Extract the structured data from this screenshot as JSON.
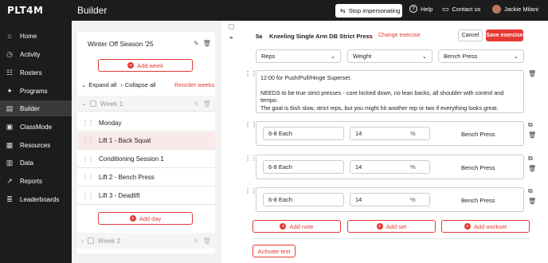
{
  "app": {
    "logo": "PLT4M",
    "page_title": "Builder"
  },
  "topbar": {
    "impersonate_label": "Stop impersonating",
    "help_label": "Help",
    "contact_label": "Contact us",
    "user_name": "Jackie Milani"
  },
  "nav": [
    {
      "label": "Home",
      "icon": "home-icon"
    },
    {
      "label": "Activity",
      "icon": "activity-icon"
    },
    {
      "label": "Rosters",
      "icon": "rosters-icon"
    },
    {
      "label": "Programs",
      "icon": "programs-icon"
    },
    {
      "label": "Builder",
      "icon": "builder-icon",
      "active": true
    },
    {
      "label": "ClassMode",
      "icon": "classmode-icon"
    },
    {
      "label": "Resources",
      "icon": "resources-icon"
    },
    {
      "label": "Data",
      "icon": "data-icon"
    },
    {
      "label": "Reports",
      "icon": "reports-icon"
    },
    {
      "label": "Leaderboards",
      "icon": "leaderboards-icon"
    }
  ],
  "program": {
    "name": "Winter Off Season '25",
    "add_week_label": "Add week",
    "expand_all": "Expand all",
    "collapse_all": "Collapse all",
    "reorder_weeks": "Reorder weeks",
    "week1_label": "Week 1",
    "week2_label": "Week 2",
    "days": [
      "Monday",
      "Lift 1 - Back Squat",
      "Conditioning Session 1",
      "Lift 2 - Bench Press",
      "Lift 3 - Deadlift"
    ],
    "add_day_label": "Add day"
  },
  "exercise": {
    "code": "5a",
    "name": "Kneeling Single Arm DB Strict Press",
    "change_label": "Change exercise",
    "cancel_label": "Cancel",
    "save_label": "Save exercise",
    "col1": "Reps",
    "col2": "Weight",
    "col3": "Bench Press",
    "note_line1": "12:00 for Push/Pull/Hinge Superset.",
    "note_line2": "NEEDS to be true strict presses - core locked down, no lean backs, all shoulder with control and tempo.",
    "note_line3": "The goal is 6ish slow, strict reps, but you might hit another rep or two if everything looks great.",
    "sets": [
      {
        "reps": "6-8 Each",
        "weight": "14",
        "unit": "%",
        "ref": "Bench Press"
      },
      {
        "reps": "6-8 Each",
        "weight": "14",
        "unit": "%",
        "ref": "Bench Press"
      },
      {
        "reps": "6-8 Each",
        "weight": "14",
        "unit": "%",
        "ref": "Bench Press"
      }
    ],
    "add_note_label": "Add note",
    "add_set_label": "Add set",
    "add_workset_label": "Add workset",
    "activate_test_label": "Activate test"
  },
  "colors": {
    "accent": "#e53935",
    "dark": "#1c1c1c"
  }
}
